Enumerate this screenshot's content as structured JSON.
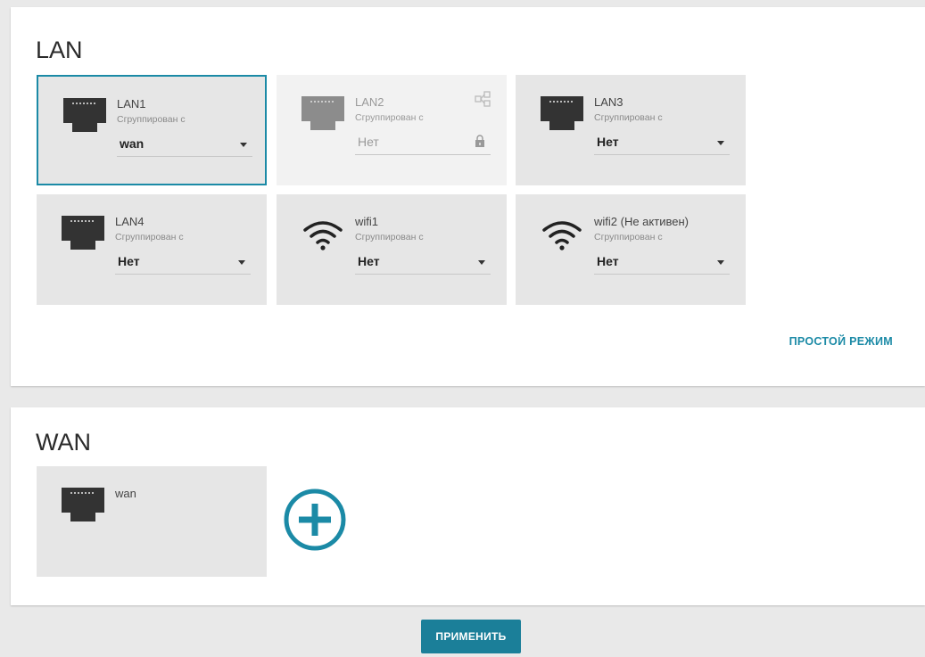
{
  "lan": {
    "title": "LAN",
    "mode_link": "ПРОСТОЙ РЕЖИМ",
    "ports": [
      {
        "name": "LAN1",
        "subtitle": "Сгруппирован с",
        "value": "wan",
        "icon": "ethernet-port-icon"
      },
      {
        "name": "LAN2",
        "subtitle": "Сгруппирован с",
        "value": "Нет",
        "icon": "ethernet-port-icon"
      },
      {
        "name": "LAN3",
        "subtitle": "Сгруппирован с",
        "value": "Нет",
        "icon": "ethernet-port-icon"
      },
      {
        "name": "LAN4",
        "subtitle": "Сгруппирован с",
        "value": "Нет",
        "icon": "ethernet-port-icon"
      },
      {
        "name": "wifi1",
        "subtitle": "Сгруппирован с",
        "value": "Нет",
        "icon": "wifi-icon"
      },
      {
        "name": "wifi2 (Не активен)",
        "subtitle": "Сгруппирован с",
        "value": "Нет",
        "icon": "wifi-icon"
      }
    ]
  },
  "wan": {
    "title": "WAN",
    "interfaces": [
      {
        "name": "wan",
        "icon": "ethernet-port-icon"
      }
    ],
    "add_icon": "plus-circle-icon"
  },
  "footer": {
    "apply_label": "ПРИМЕНИТЬ"
  },
  "colors": {
    "accent": "#1b8aa6",
    "button": "#1b7f99",
    "card": "#e6e6e6",
    "card_disabled": "#f2f2f2"
  }
}
